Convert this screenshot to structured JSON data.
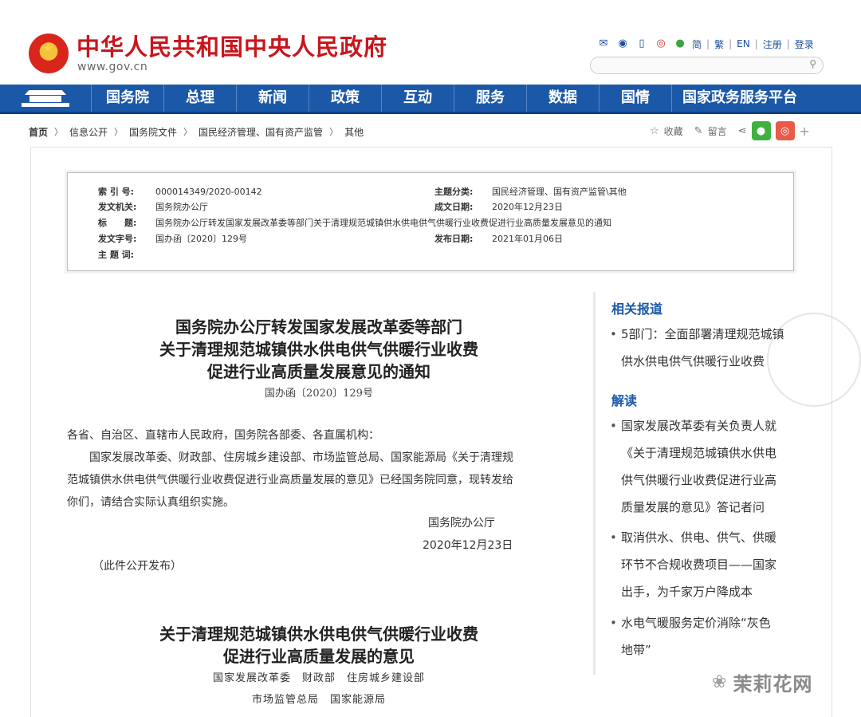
{
  "header": {
    "site_title": "中华人民共和国中央人民政府",
    "site_url": "www.gov.cn",
    "links": {
      "simplified": "简",
      "traditional": "繁",
      "english": "EN",
      "register": "注册",
      "login": "登录",
      "sep": "|"
    },
    "search_placeholder": ""
  },
  "nav": {
    "items": [
      "国务院",
      "总理",
      "新闻",
      "政策",
      "互动",
      "服务",
      "数据",
      "国情",
      "国家政务服务平台"
    ]
  },
  "breadcrumb": {
    "items": [
      "首页",
      "信息公开",
      "国务院文件",
      "国民经济管理、国有资产监管",
      "其他"
    ],
    "arrow": "〉"
  },
  "tools": {
    "favorite": "收藏",
    "comment": "留言",
    "plus": "+"
  },
  "info": {
    "index_label": "索 引 号:",
    "index_value": "000014349/2020-00142",
    "subject_label": "主题分类:",
    "subject_value": "国民经济管理、国有资产监管\\其他",
    "issuer_label": "发文机关:",
    "issuer_value": "国务院办公厅",
    "date_label": "成文日期:",
    "date_value": "2020年12月23日",
    "title_label": "标　　题:",
    "title_value": "国务院办公厅转发国家发展改革委等部门关于清理规范城镇供水供电供气供暖行业收费促进行业高质量发展意见的通知",
    "docno_label": "发文字号:",
    "docno_value": "国办函〔2020〕129号",
    "publish_label": "发布日期:",
    "publish_value": "2021年01月06日",
    "keywords_label": "主 题 词:"
  },
  "article": {
    "title_lines": [
      "国务院办公厅转发国家发展改革委等部门",
      "关于清理规范城镇供水供电供气供暖行业收费",
      "促进行业高质量发展意见的通知"
    ],
    "doc_no": "国办函〔2020〕129号",
    "salutation": "各省、自治区、直辖市人民政府，国务院各部委、各直属机构：",
    "body_lines": [
      "国家发展改革委、财政部、住房城乡建设部、市场监管总局、国家能源局《关于清理规",
      "范城镇供水供电供气供暖行业收费促进行业高质量发展的意见》已经国务院同意，现转发给",
      "你们，请结合实际认真组织实施。"
    ],
    "signer": "国务院办公厅",
    "sign_date": "2020年12月23日",
    "public_note": "（此件公开发布）",
    "second_title_lines": [
      "关于清理规范城镇供水供电供气供暖行业收费",
      "促进行业高质量发展的意见"
    ],
    "second_sub_1": "国家发展改革委　财政部　住房城乡建设部",
    "second_sub_2": "市场监管总局　国家能源局"
  },
  "sidebar": {
    "related_heading": "相关报道",
    "related_items": [
      [
        "5部门：全面部署清理规范城镇",
        "供水供电供气供暖行业收费"
      ]
    ],
    "interpret_heading": "解读",
    "interpret_items": [
      [
        "国家发展改革委有关负责人就",
        "《关于清理规范城镇供水供电",
        "供气供暖行业收费促进行业高",
        "质量发展的意见》答记者问"
      ],
      [
        "取消供水、供电、供气、供暖",
        "环节不合规收费项目——国家",
        "出手，为千家万户降成本"
      ],
      [
        "水电气暖服务定价消除“灰色",
        "地带”"
      ]
    ],
    "bullet": "•"
  },
  "watermark": {
    "brand": "茉莉花网"
  },
  "colors": {
    "title_red": "#c8161d",
    "nav_blue": "#1b58a7",
    "sidebar_blue": "#1b58a7"
  }
}
